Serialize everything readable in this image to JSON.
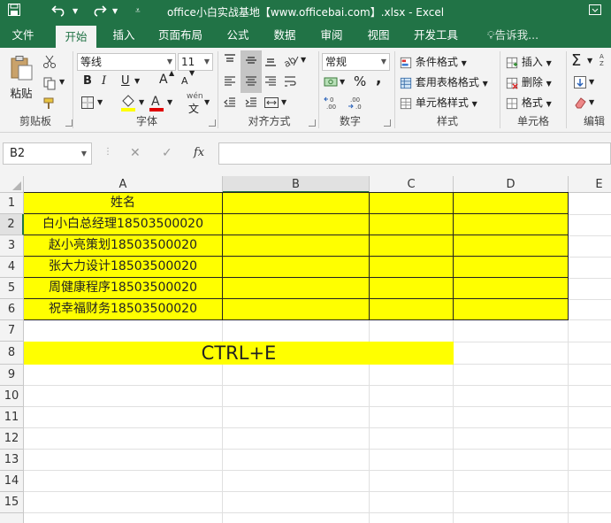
{
  "window": {
    "title": "office小白实战基地【www.officebai.com】.xlsx - Excel"
  },
  "quick_access": {
    "save": "save-icon",
    "undo": "undo-icon",
    "redo": "redo-icon",
    "customize": "customize-icon"
  },
  "tabs": [
    {
      "label": "文件"
    },
    {
      "label": "开始"
    },
    {
      "label": "插入"
    },
    {
      "label": "页面布局"
    },
    {
      "label": "公式"
    },
    {
      "label": "数据"
    },
    {
      "label": "审阅"
    },
    {
      "label": "视图"
    },
    {
      "label": "开发工具"
    }
  ],
  "tell_me": "告诉我...",
  "ribbon": {
    "clipboard": {
      "paste": "粘贴",
      "label": "剪贴板"
    },
    "font": {
      "name": "等线",
      "size": "11",
      "bold": "B",
      "italic": "I",
      "underline": "U",
      "grow": "A",
      "shrink": "A",
      "wen": "wén",
      "label": "字体"
    },
    "align": {
      "label": "对齐方式"
    },
    "number": {
      "format": "常规",
      "percent": "%",
      "comma": ",",
      "label": "数字"
    },
    "styles": {
      "cond": "条件格式",
      "table": "套用表格格式",
      "cell": "单元格样式",
      "label": "样式"
    },
    "cells": {
      "insert": "插入",
      "delete": "删除",
      "format": "格式",
      "label": "单元格"
    },
    "editing": {
      "label": "编辑"
    }
  },
  "formula_bar": {
    "name_box": "B2",
    "fx": "fx",
    "value": ""
  },
  "columns": [
    "A",
    "B",
    "C",
    "D",
    "E"
  ],
  "rows": [
    "1",
    "2",
    "3",
    "4",
    "5",
    "6",
    "7",
    "8",
    "9",
    "10",
    "11",
    "12",
    "13",
    "14",
    "15"
  ],
  "cells": {
    "A1": "姓名",
    "A2": "白小白总经理18503500020",
    "A3": "赵小亮策划18503500020",
    "A4": "张大力设计18503500020",
    "A5": "周健康程序18503500020",
    "A6": "祝幸福财务18503500020",
    "A8": "CTRL+E"
  },
  "colors": {
    "excel_green": "#217346",
    "highlight": "#ffff00"
  }
}
